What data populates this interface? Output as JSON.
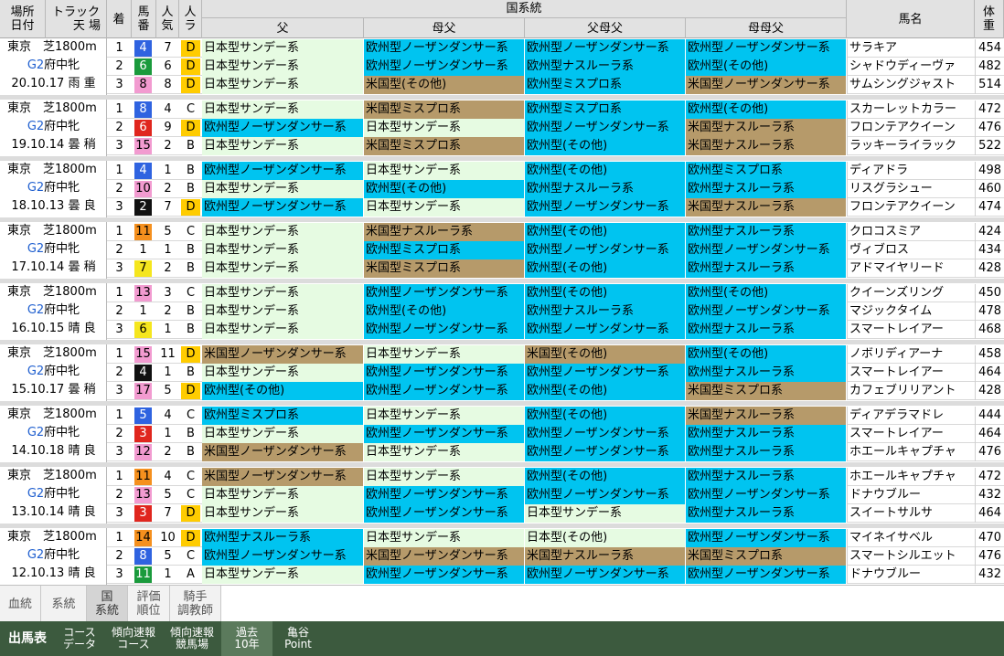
{
  "colors": {
    "nihon": "#e6fbe2",
    "oshu": "#00c4f0",
    "beikoku": "#b69a6a",
    "header_bg": "#e2e2e2",
    "nav_bg": "#3c5a3e",
    "mark_d": "#ffcc00",
    "grade": "#1f5fcf"
  },
  "header": {
    "place": "場所",
    "date": "日付",
    "track": "トラック",
    "weather_going": "天 場",
    "finish": "着",
    "horse_number": "馬番",
    "popularity": "人気",
    "rank": "人ラ",
    "lineage_group": "国系統",
    "sire": "父",
    "dam_sire": "母父",
    "sire_dam_sire": "父母父",
    "dam_dam_sire": "母母父",
    "horse_name": "馬名",
    "weight": "体重"
  },
  "races": [
    {
      "place_track": "東京　芝1800m",
      "grade": "G2",
      "race_name": "府中牝",
      "date_cond": "20.10.17 雨 重",
      "rows": [
        {
          "finish": "1",
          "num": "4",
          "numbg": "#2f63e0",
          "numfg": "#ffffff",
          "pop": "7",
          "mark": "D",
          "sire": "日本型サンデー系",
          "sire_t": "nihon",
          "ds": "欧州型ノーザンダンサー系",
          "ds_t": "oshu",
          "sds": "欧州型ノーザンダンサー系",
          "sds_t": "oshu",
          "dds": "欧州型ノーザンダンサー系",
          "dds_t": "oshu",
          "horse": "サラキア",
          "weight": "454"
        },
        {
          "finish": "2",
          "num": "6",
          "numbg": "#1a9a3c",
          "numfg": "#ffffff",
          "pop": "6",
          "mark": "D",
          "sire": "日本型サンデー系",
          "sire_t": "nihon",
          "ds": "欧州型ノーザンダンサー系",
          "ds_t": "oshu",
          "sds": "欧州型ナスルーラ系",
          "sds_t": "oshu",
          "dds": "欧州型(その他)",
          "dds_t": "oshu",
          "horse": "シャドウディーヴァ",
          "weight": "482"
        },
        {
          "finish": "3",
          "num": "8",
          "numbg": "#f29bd0",
          "numfg": "#000000",
          "pop": "8",
          "mark": "D",
          "sire": "日本型サンデー系",
          "sire_t": "nihon",
          "ds": "米国型(その他)",
          "ds_t": "beikoku",
          "sds": "欧州型ミスプロ系",
          "sds_t": "oshu",
          "dds": "米国型ノーザンダンサー系",
          "dds_t": "beikoku",
          "horse": "サムシングジャスト",
          "weight": "514"
        }
      ]
    },
    {
      "place_track": "東京　芝1800m",
      "grade": "G2",
      "race_name": "府中牝",
      "date_cond": "19.10.14 曇 稍",
      "rows": [
        {
          "finish": "1",
          "num": "8",
          "numbg": "#2f63e0",
          "numfg": "#ffffff",
          "pop": "4",
          "mark": "C",
          "sire": "日本型サンデー系",
          "sire_t": "nihon",
          "ds": "米国型ミスプロ系",
          "ds_t": "beikoku",
          "sds": "欧州型ミスプロ系",
          "sds_t": "oshu",
          "dds": "欧州型(その他)",
          "dds_t": "oshu",
          "horse": "スカーレットカラー",
          "weight": "472"
        },
        {
          "finish": "2",
          "num": "6",
          "numbg": "#e0261e",
          "numfg": "#ffffff",
          "pop": "9",
          "mark": "D",
          "sire": "欧州型ノーザンダンサー系",
          "sire_t": "oshu",
          "ds": "日本型サンデー系",
          "ds_t": "nihon",
          "sds": "欧州型ノーザンダンサー系",
          "sds_t": "oshu",
          "dds": "米国型ナスルーラ系",
          "dds_t": "beikoku",
          "horse": "フロンテアクイーン",
          "weight": "476"
        },
        {
          "finish": "3",
          "num": "15",
          "numbg": "#f29bd0",
          "numfg": "#000000",
          "pop": "2",
          "mark": "B",
          "sire": "日本型サンデー系",
          "sire_t": "nihon",
          "ds": "米国型ミスプロ系",
          "ds_t": "beikoku",
          "sds": "欧州型(その他)",
          "sds_t": "oshu",
          "dds": "米国型ナスルーラ系",
          "dds_t": "beikoku",
          "horse": "ラッキーライラック",
          "weight": "522"
        }
      ]
    },
    {
      "place_track": "東京　芝1800m",
      "grade": "G2",
      "race_name": "府中牝",
      "date_cond": "18.10.13 曇 良",
      "rows": [
        {
          "finish": "1",
          "num": "4",
          "numbg": "#2f63e0",
          "numfg": "#ffffff",
          "pop": "1",
          "mark": "B",
          "sire": "欧州型ノーザンダンサー系",
          "sire_t": "oshu",
          "ds": "日本型サンデー系",
          "ds_t": "nihon",
          "sds": "欧州型(その他)",
          "sds_t": "oshu",
          "dds": "欧州型ミスプロ系",
          "dds_t": "oshu",
          "horse": "ディアドラ",
          "weight": "498"
        },
        {
          "finish": "2",
          "num": "10",
          "numbg": "#f29bd0",
          "numfg": "#000000",
          "pop": "2",
          "mark": "B",
          "sire": "日本型サンデー系",
          "sire_t": "nihon",
          "ds": "欧州型(その他)",
          "ds_t": "oshu",
          "sds": "欧州型ナスルーラ系",
          "sds_t": "oshu",
          "dds": "欧州型ナスルーラ系",
          "dds_t": "oshu",
          "horse": "リスグラシュー",
          "weight": "460"
        },
        {
          "finish": "3",
          "num": "2",
          "numbg": "#111111",
          "numfg": "#ffffff",
          "pop": "7",
          "mark": "D",
          "sire": "欧州型ノーザンダンサー系",
          "sire_t": "oshu",
          "ds": "日本型サンデー系",
          "ds_t": "nihon",
          "sds": "欧州型ノーザンダンサー系",
          "sds_t": "oshu",
          "dds": "米国型ナスルーラ系",
          "dds_t": "beikoku",
          "horse": "フロンテアクイーン",
          "weight": "474"
        }
      ]
    },
    {
      "place_track": "東京　芝1800m",
      "grade": "G2",
      "race_name": "府中牝",
      "date_cond": "17.10.14 曇 稍",
      "rows": [
        {
          "finish": "1",
          "num": "11",
          "numbg": "#f5901e",
          "numfg": "#000000",
          "pop": "5",
          "mark": "C",
          "sire": "日本型サンデー系",
          "sire_t": "nihon",
          "ds": "米国型ナスルーラ系",
          "ds_t": "beikoku",
          "sds": "欧州型(その他)",
          "sds_t": "oshu",
          "dds": "欧州型ナスルーラ系",
          "dds_t": "oshu",
          "horse": "クロコスミア",
          "weight": "424"
        },
        {
          "finish": "2",
          "num": "1",
          "numbg": "#ffffff",
          "numfg": "#000000",
          "pop": "1",
          "mark": "B",
          "sire": "日本型サンデー系",
          "sire_t": "nihon",
          "ds": "欧州型ミスプロ系",
          "ds_t": "oshu",
          "sds": "欧州型ノーザンダンサー系",
          "sds_t": "oshu",
          "dds": "欧州型ノーザンダンサー系",
          "dds_t": "oshu",
          "horse": "ヴィブロス",
          "weight": "434"
        },
        {
          "finish": "3",
          "num": "7",
          "numbg": "#f5e61e",
          "numfg": "#000000",
          "pop": "2",
          "mark": "B",
          "sire": "日本型サンデー系",
          "sire_t": "nihon",
          "ds": "米国型ミスプロ系",
          "ds_t": "beikoku",
          "sds": "欧州型(その他)",
          "sds_t": "oshu",
          "dds": "欧州型ナスルーラ系",
          "dds_t": "oshu",
          "horse": "アドマイヤリード",
          "weight": "428"
        }
      ]
    },
    {
      "place_track": "東京　芝1800m",
      "grade": "G2",
      "race_name": "府中牝",
      "date_cond": "16.10.15 晴 良",
      "rows": [
        {
          "finish": "1",
          "num": "13",
          "numbg": "#f29bd0",
          "numfg": "#000000",
          "pop": "3",
          "mark": "C",
          "sire": "日本型サンデー系",
          "sire_t": "nihon",
          "ds": "欧州型ノーザンダンサー系",
          "ds_t": "oshu",
          "sds": "欧州型(その他)",
          "sds_t": "oshu",
          "dds": "欧州型(その他)",
          "dds_t": "oshu",
          "horse": "クイーンズリング",
          "weight": "450"
        },
        {
          "finish": "2",
          "num": "1",
          "numbg": "#ffffff",
          "numfg": "#000000",
          "pop": "2",
          "mark": "B",
          "sire": "日本型サンデー系",
          "sire_t": "nihon",
          "ds": "欧州型(その他)",
          "ds_t": "oshu",
          "sds": "欧州型ナスルーラ系",
          "sds_t": "oshu",
          "dds": "欧州型ノーザンダンサー系",
          "dds_t": "oshu",
          "horse": "マジックタイム",
          "weight": "478"
        },
        {
          "finish": "3",
          "num": "6",
          "numbg": "#f5e61e",
          "numfg": "#000000",
          "pop": "1",
          "mark": "B",
          "sire": "日本型サンデー系",
          "sire_t": "nihon",
          "ds": "欧州型ノーザンダンサー系",
          "ds_t": "oshu",
          "sds": "欧州型ノーザンダンサー系",
          "sds_t": "oshu",
          "dds": "欧州型ナスルーラ系",
          "dds_t": "oshu",
          "horse": "スマートレイアー",
          "weight": "468"
        }
      ]
    },
    {
      "place_track": "東京　芝1800m",
      "grade": "G2",
      "race_name": "府中牝",
      "date_cond": "15.10.17 曇 稍",
      "rows": [
        {
          "finish": "1",
          "num": "15",
          "numbg": "#f29bd0",
          "numfg": "#000000",
          "pop": "11",
          "mark": "D",
          "sire": "米国型ノーザンダンサー系",
          "sire_t": "beikoku",
          "ds": "日本型サンデー系",
          "ds_t": "nihon",
          "sds": "米国型(その他)",
          "sds_t": "beikoku",
          "dds": "欧州型(その他)",
          "dds_t": "oshu",
          "horse": "ノボリディアーナ",
          "weight": "458"
        },
        {
          "finish": "2",
          "num": "4",
          "numbg": "#111111",
          "numfg": "#ffffff",
          "pop": "1",
          "mark": "B",
          "sire": "日本型サンデー系",
          "sire_t": "nihon",
          "ds": "欧州型ノーザンダンサー系",
          "ds_t": "oshu",
          "sds": "欧州型ノーザンダンサー系",
          "sds_t": "oshu",
          "dds": "欧州型ナスルーラ系",
          "dds_t": "oshu",
          "horse": "スマートレイアー",
          "weight": "464"
        },
        {
          "finish": "3",
          "num": "17",
          "numbg": "#f29bd0",
          "numfg": "#000000",
          "pop": "5",
          "mark": "D",
          "sire": "欧州型(その他)",
          "sire_t": "oshu",
          "ds": "欧州型ノーザンダンサー系",
          "ds_t": "oshu",
          "sds": "欧州型(その他)",
          "sds_t": "oshu",
          "dds": "米国型ミスプロ系",
          "dds_t": "beikoku",
          "horse": "カフェブリリアント",
          "weight": "428"
        }
      ]
    },
    {
      "place_track": "東京　芝1800m",
      "grade": "G2",
      "race_name": "府中牝",
      "date_cond": "14.10.18 晴 良",
      "rows": [
        {
          "finish": "1",
          "num": "5",
          "numbg": "#2f63e0",
          "numfg": "#ffffff",
          "pop": "4",
          "mark": "C",
          "sire": "欧州型ミスプロ系",
          "sire_t": "oshu",
          "ds": "日本型サンデー系",
          "ds_t": "nihon",
          "sds": "欧州型(その他)",
          "sds_t": "oshu",
          "dds": "米国型ナスルーラ系",
          "dds_t": "beikoku",
          "horse": "ディアデラマドレ",
          "weight": "444"
        },
        {
          "finish": "2",
          "num": "3",
          "numbg": "#e0261e",
          "numfg": "#ffffff",
          "pop": "1",
          "mark": "B",
          "sire": "日本型サンデー系",
          "sire_t": "nihon",
          "ds": "欧州型ノーザンダンサー系",
          "ds_t": "oshu",
          "sds": "欧州型ノーザンダンサー系",
          "sds_t": "oshu",
          "dds": "欧州型ナスルーラ系",
          "dds_t": "oshu",
          "horse": "スマートレイアー",
          "weight": "464"
        },
        {
          "finish": "3",
          "num": "12",
          "numbg": "#f29bd0",
          "numfg": "#000000",
          "pop": "2",
          "mark": "B",
          "sire": "米国型ノーザンダンサー系",
          "sire_t": "beikoku",
          "ds": "日本型サンデー系",
          "ds_t": "nihon",
          "sds": "欧州型ノーザンダンサー系",
          "sds_t": "oshu",
          "dds": "欧州型ナスルーラ系",
          "dds_t": "oshu",
          "horse": "ホエールキャプチャ",
          "weight": "476"
        }
      ]
    },
    {
      "place_track": "東京　芝1800m",
      "grade": "G2",
      "race_name": "府中牝",
      "date_cond": "13.10.14 晴 良",
      "rows": [
        {
          "finish": "1",
          "num": "11",
          "numbg": "#f5901e",
          "numfg": "#000000",
          "pop": "4",
          "mark": "C",
          "sire": "米国型ノーザンダンサー系",
          "sire_t": "beikoku",
          "ds": "日本型サンデー系",
          "ds_t": "nihon",
          "sds": "欧州型(その他)",
          "sds_t": "oshu",
          "dds": "欧州型ナスルーラ系",
          "dds_t": "oshu",
          "horse": "ホエールキャプチャ",
          "weight": "472"
        },
        {
          "finish": "2",
          "num": "13",
          "numbg": "#f29bd0",
          "numfg": "#000000",
          "pop": "5",
          "mark": "C",
          "sire": "日本型サンデー系",
          "sire_t": "nihon",
          "ds": "欧州型ノーザンダンサー系",
          "ds_t": "oshu",
          "sds": "欧州型ノーザンダンサー系",
          "sds_t": "oshu",
          "dds": "欧州型ノーザンダンサー系",
          "dds_t": "oshu",
          "horse": "ドナウブルー",
          "weight": "432"
        },
        {
          "finish": "3",
          "num": "3",
          "numbg": "#e0261e",
          "numfg": "#ffffff",
          "pop": "7",
          "mark": "D",
          "sire": "日本型サンデー系",
          "sire_t": "nihon",
          "ds": "欧州型ノーザンダンサー系",
          "ds_t": "oshu",
          "sds": "日本型サンデー系",
          "sds_t": "nihon",
          "dds": "欧州型ナスルーラ系",
          "dds_t": "oshu",
          "horse": "スイートサルサ",
          "weight": "464"
        }
      ]
    },
    {
      "place_track": "東京　芝1800m",
      "grade": "G2",
      "race_name": "府中牝",
      "date_cond": "12.10.13 晴 良",
      "rows": [
        {
          "finish": "1",
          "num": "14",
          "numbg": "#f5901e",
          "numfg": "#000000",
          "pop": "10",
          "mark": "D",
          "sire": "欧州型ナスルーラ系",
          "sire_t": "oshu",
          "ds": "日本型サンデー系",
          "ds_t": "nihon",
          "sds": "日本型(その他)",
          "sds_t": "nihon",
          "dds": "欧州型ノーザンダンサー系",
          "dds_t": "oshu",
          "horse": "マイネイサベル",
          "weight": "470"
        },
        {
          "finish": "2",
          "num": "8",
          "numbg": "#2f63e0",
          "numfg": "#ffffff",
          "pop": "5",
          "mark": "C",
          "sire": "欧州型ノーザンダンサー系",
          "sire_t": "oshu",
          "ds": "米国型ノーザンダンサー系",
          "ds_t": "beikoku",
          "sds": "米国型ナスルーラ系",
          "sds_t": "beikoku",
          "dds": "米国型ミスプロ系",
          "dds_t": "beikoku",
          "horse": "スマートシルエット",
          "weight": "476"
        },
        {
          "finish": "3",
          "num": "11",
          "numbg": "#1a9a3c",
          "numfg": "#ffffff",
          "pop": "1",
          "mark": "A",
          "sire": "日本型サンデー系",
          "sire_t": "nihon",
          "ds": "欧州型ノーザンダンサー系",
          "ds_t": "oshu",
          "sds": "欧州型ノーザンダンサー系",
          "sds_t": "oshu",
          "dds": "欧州型ノーザンダンサー系",
          "dds_t": "oshu",
          "horse": "ドナウブルー",
          "weight": "432"
        }
      ]
    }
  ],
  "tabs": [
    {
      "label": "血統",
      "active": false
    },
    {
      "label": "系統",
      "active": false
    },
    {
      "label": "国\n系統",
      "active": true
    },
    {
      "label": "評価\n順位",
      "active": false
    },
    {
      "label": "騎手\n調教師",
      "active": false
    }
  ],
  "nav": [
    {
      "label": "出馬表",
      "big": true,
      "active": false
    },
    {
      "label": "コース\nデータ",
      "big": false,
      "active": false
    },
    {
      "label": "傾向速報\nコース",
      "big": false,
      "active": false
    },
    {
      "label": "傾向速報\n競馬場",
      "big": false,
      "active": false
    },
    {
      "label": "過去\n10年",
      "big": false,
      "active": true
    },
    {
      "label": "亀谷\nPoint",
      "big": false,
      "active": false
    }
  ]
}
